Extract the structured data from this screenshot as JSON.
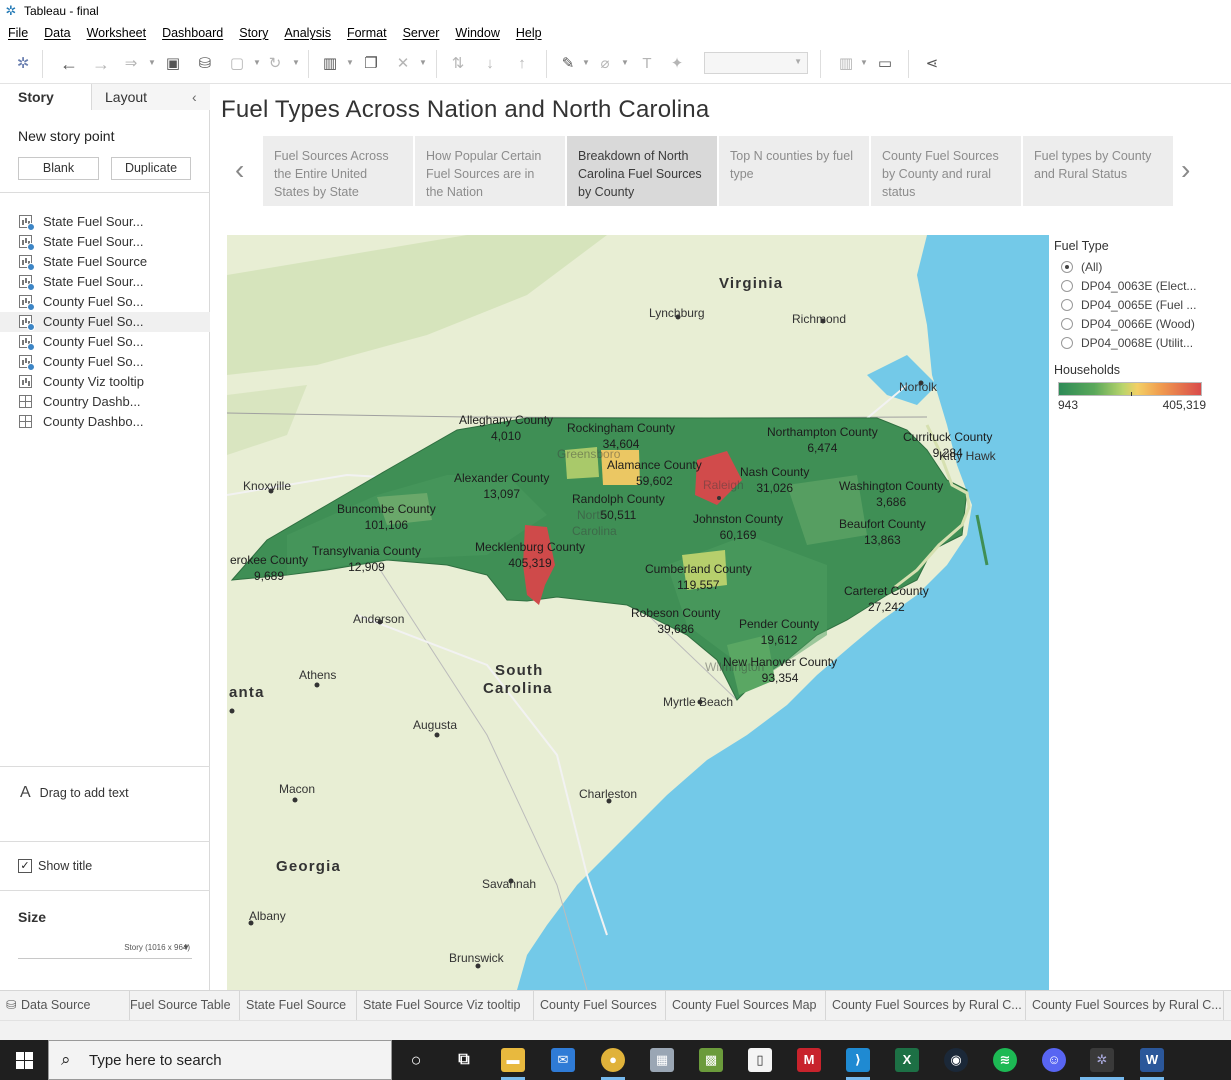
{
  "window": {
    "title": "Tableau - final"
  },
  "menu": [
    "File",
    "Data",
    "Worksheet",
    "Dashboard",
    "Story",
    "Analysis",
    "Format",
    "Server",
    "Window",
    "Help"
  ],
  "toolbar_icons": [
    "tableau-logo-icon",
    "undo-icon",
    "redo-icon",
    "replay-icon",
    "save-icon",
    "new-datasource-icon",
    "pause-icon",
    "refresh-icon",
    "new-worksheet-icon",
    "duplicate-icon",
    "clear-icon",
    "swap-icon",
    "sort-asc-icon",
    "sort-desc-icon",
    "highlight-icon",
    "group-icon",
    "label-icon",
    "pin-icon",
    "fit-combo",
    "show-me-icon",
    "presentation-icon",
    "share-icon"
  ],
  "sidebar": {
    "tabs": {
      "story": "Story",
      "layout": "Layout"
    },
    "new_story_point": "New story point",
    "blank_button": "Blank",
    "duplicate_button": "Duplicate",
    "sheets": [
      {
        "label": "State Fuel Sour...",
        "icon": "bar",
        "check": true,
        "selected": false
      },
      {
        "label": "State Fuel Sour...",
        "icon": "bar",
        "check": true,
        "selected": false
      },
      {
        "label": "State Fuel Source",
        "icon": "bar",
        "check": true,
        "selected": false
      },
      {
        "label": "State Fuel Sour...",
        "icon": "bar",
        "check": true,
        "selected": false
      },
      {
        "label": "County Fuel So...",
        "icon": "bar",
        "check": true,
        "selected": false
      },
      {
        "label": "County Fuel So...",
        "icon": "bar",
        "check": true,
        "selected": true
      },
      {
        "label": "County Fuel So...",
        "icon": "bar",
        "check": true,
        "selected": false
      },
      {
        "label": "County Fuel So...",
        "icon": "bar",
        "check": true,
        "selected": false
      },
      {
        "label": "County Viz tooltip",
        "icon": "bar",
        "check": false,
        "selected": false
      },
      {
        "label": "Country Dashb...",
        "icon": "grid",
        "check": false,
        "selected": false
      },
      {
        "label": "County Dashbo...",
        "icon": "grid",
        "check": false,
        "selected": false
      }
    ],
    "drag_text": "Drag to add text",
    "show_title": "Show title",
    "size_heading": "Size",
    "size_value": "Story (1016 x 964)"
  },
  "story": {
    "title": "Fuel Types Across Nation and North Carolina",
    "points": [
      {
        "text": "Fuel Sources Across the Entire United States by State",
        "selected": false
      },
      {
        "text": "How Popular Certain Fuel Sources are in the Nation",
        "selected": false
      },
      {
        "text": "Breakdown of North Carolina Fuel Sources by County",
        "selected": true
      },
      {
        "text": "Top N counties by fuel type",
        "selected": false
      },
      {
        "text": "County Fuel Sources by County and rural status",
        "selected": false
      },
      {
        "text": "Fuel types by County and Rural Status",
        "selected": false
      }
    ]
  },
  "map": {
    "places": [
      "Virginia",
      "Lynchburg",
      "Richmond",
      "Norfolk",
      "Knoxville",
      "Kitty Hawk",
      "Greensboro",
      "Raleigh",
      "North",
      "Carolina",
      "Anderson",
      "Athens",
      "anta",
      "South",
      "Carolina",
      "Augusta",
      "Myrtle Beach",
      "Wilmington",
      "Macon",
      "Charleston",
      "Georgia",
      "Savannah",
      "Albany",
      "Brunswick"
    ],
    "counties": [
      {
        "name": "Alleghany County",
        "value": "4,010"
      },
      {
        "name": "Rockingham County",
        "value": "34,604"
      },
      {
        "name": "Northampton County",
        "value": "6,474"
      },
      {
        "name": "Currituck County",
        "value": "9,284"
      },
      {
        "name": "Alamance County",
        "value": "59,602"
      },
      {
        "name": "Alexander County",
        "value": "13,097"
      },
      {
        "name": "Nash County",
        "value": "31,026"
      },
      {
        "name": "Washington County",
        "value": "3,686"
      },
      {
        "name": "Buncombe County",
        "value": "101,106"
      },
      {
        "name": "Randolph County",
        "value": "50,511"
      },
      {
        "name": "Johnston County",
        "value": "60,169"
      },
      {
        "name": "Beaufort County",
        "value": "13,863"
      },
      {
        "name": "Mecklenburg County",
        "value": "405,319"
      },
      {
        "name": "Transylvania County",
        "value": "12,909"
      },
      {
        "name": "erokee County",
        "value": "9,689"
      },
      {
        "name": "Cumberland County",
        "value": "119,557"
      },
      {
        "name": "Carteret County",
        "value": "27,242"
      },
      {
        "name": "Robeson County",
        "value": "39,686"
      },
      {
        "name": "Pender County",
        "value": "19,612"
      },
      {
        "name": "New Hanover County",
        "value": "93,354"
      }
    ]
  },
  "legend": {
    "fuel_title": "Fuel Type",
    "options": [
      {
        "label": "(All)",
        "checked": true
      },
      {
        "label": "DP04_0063E (Elect...",
        "checked": false
      },
      {
        "label": "DP04_0065E (Fuel ...",
        "checked": false
      },
      {
        "label": "DP04_0066E (Wood)",
        "checked": false
      },
      {
        "label": "DP04_0068E (Utilit...",
        "checked": false
      }
    ],
    "households_title": "Households",
    "min": "943",
    "max": "405,319",
    "colors": {
      "low": "#2e8b57",
      "mid": "#f3d065",
      "high": "#d94b4b"
    }
  },
  "sheet_tabs": [
    "Data Source",
    "Fuel Source Table",
    "State Fuel Source",
    "State Fuel Source Viz tooltip",
    "County Fuel Sources",
    "County Fuel Sources Map",
    "County Fuel Sources by Rural C...",
    "County Fuel Sources by Rural C..."
  ],
  "taskbar": {
    "search_placeholder": "Type here to search",
    "apps": [
      "cortana-icon",
      "task-view-icon",
      "file-explorer-icon",
      "mail-icon",
      "chrome-icon",
      "photos-icon",
      "minecraft-icon",
      "notepad-icon",
      "marvel-icon",
      "vscode-icon",
      "excel-icon",
      "steam-icon",
      "spotify-icon",
      "discord-icon",
      "tableau-icon",
      "word-icon"
    ]
  }
}
